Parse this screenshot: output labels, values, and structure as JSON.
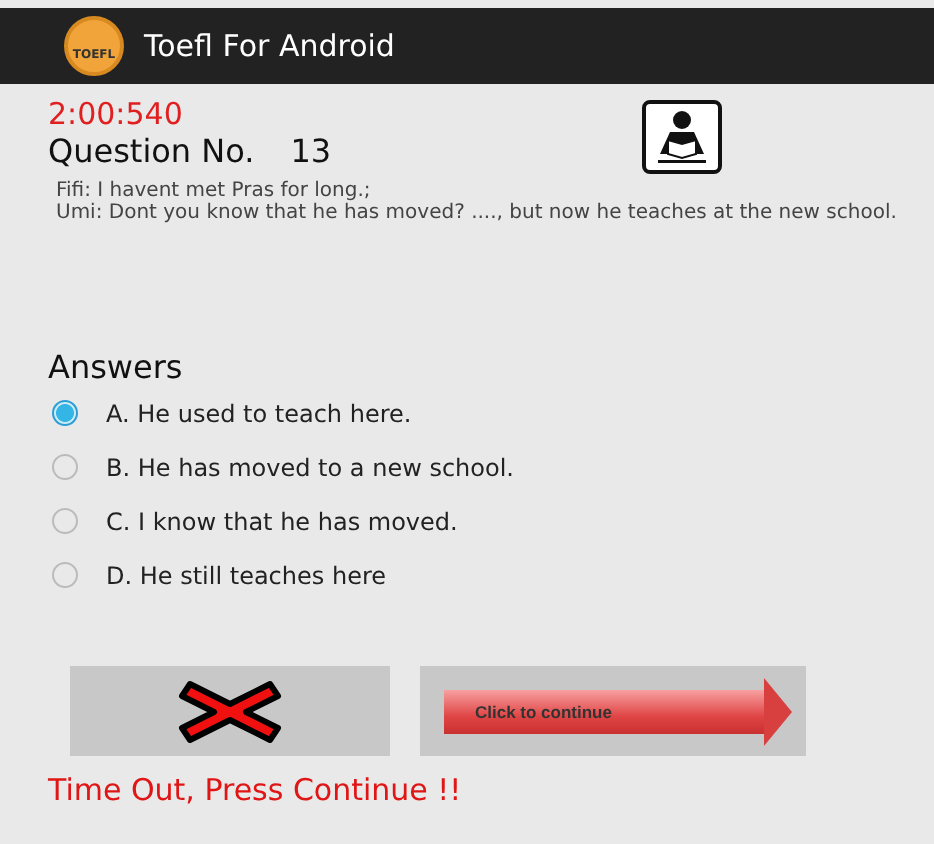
{
  "app_bar": {
    "logo_text": "TOEFL",
    "title": "Toefl For Android"
  },
  "timer": "2:00:540",
  "question_label": "Question No.",
  "question_number": "13",
  "dialogue": [
    "Fifi: I havent met Pras for long.;",
    "Umi: Dont you know that he has moved? ...., but now he teaches at the new school."
  ],
  "answers_label": "Answers",
  "answers": [
    {
      "label": "A. He used to teach here.",
      "selected": true
    },
    {
      "label": "B. He has moved to a new school.",
      "selected": false
    },
    {
      "label": "C.  I know that he has moved.",
      "selected": false
    },
    {
      "label": "D. He still teaches here",
      "selected": false
    }
  ],
  "continue_button": "Click to continue",
  "message": "Time Out, Press Continue !!"
}
